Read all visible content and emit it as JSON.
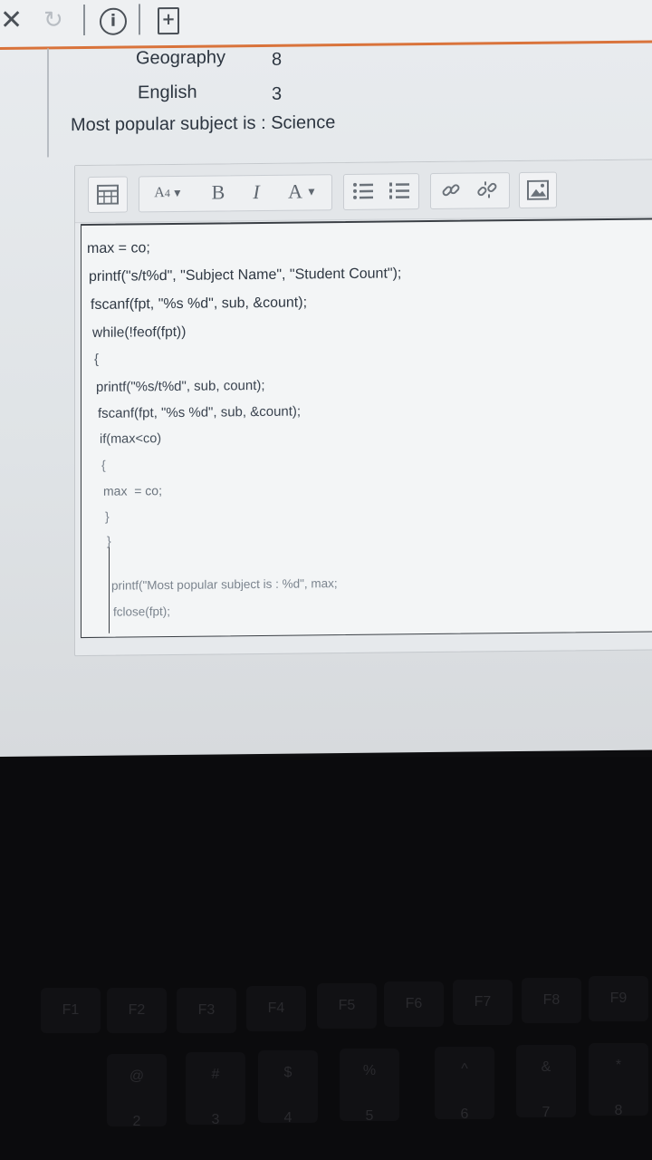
{
  "toolbar_top": {
    "close_icon": "close-icon",
    "refresh_icon": "refresh-icon",
    "info_icon": "info-icon",
    "new_doc_icon": "new-document-icon",
    "accent_color": "#d9733b"
  },
  "output": {
    "rows": [
      {
        "subject": "Geography",
        "count": "8"
      },
      {
        "subject": "English",
        "count": "3"
      }
    ],
    "summary": "Most popular subject is : Science"
  },
  "editor": {
    "toolbar": {
      "buttons": [
        "table",
        "A4",
        "B",
        "I",
        "A",
        "bulleted-list",
        "numbered-list",
        "link",
        "unlink",
        "image"
      ],
      "font_size_label": "A",
      "font_size_sub": "4",
      "bold_label": "B",
      "italic_label": "I",
      "color_label": "A"
    },
    "code_lines": [
      "max = co;",
      "printf(\"s/t%d\", \"Subject Name\", \"Student Count\");",
      "fscanf(fpt, \"%s %d\", sub, &count);",
      "while(!feof(fpt))",
      "{",
      "printf(\"%s/t%d\", sub, count);",
      "fscanf(fpt, \"%s %d\", sub, &count);",
      "if(max<co)",
      "{",
      "max  = co;",
      "}",
      "}",
      "",
      "printf(\"Most popular subject is : %d\", max;",
      "fclose(fpt);"
    ]
  },
  "keyboard": {
    "keys": [
      "F1",
      "F2",
      "F3",
      "F4",
      "F5",
      "F6",
      "F7",
      "F8",
      "F9",
      "@",
      "#",
      "$",
      "%",
      "^",
      "&",
      "*",
      "2",
      "3",
      "4",
      "5",
      "6",
      "7",
      "8"
    ]
  }
}
